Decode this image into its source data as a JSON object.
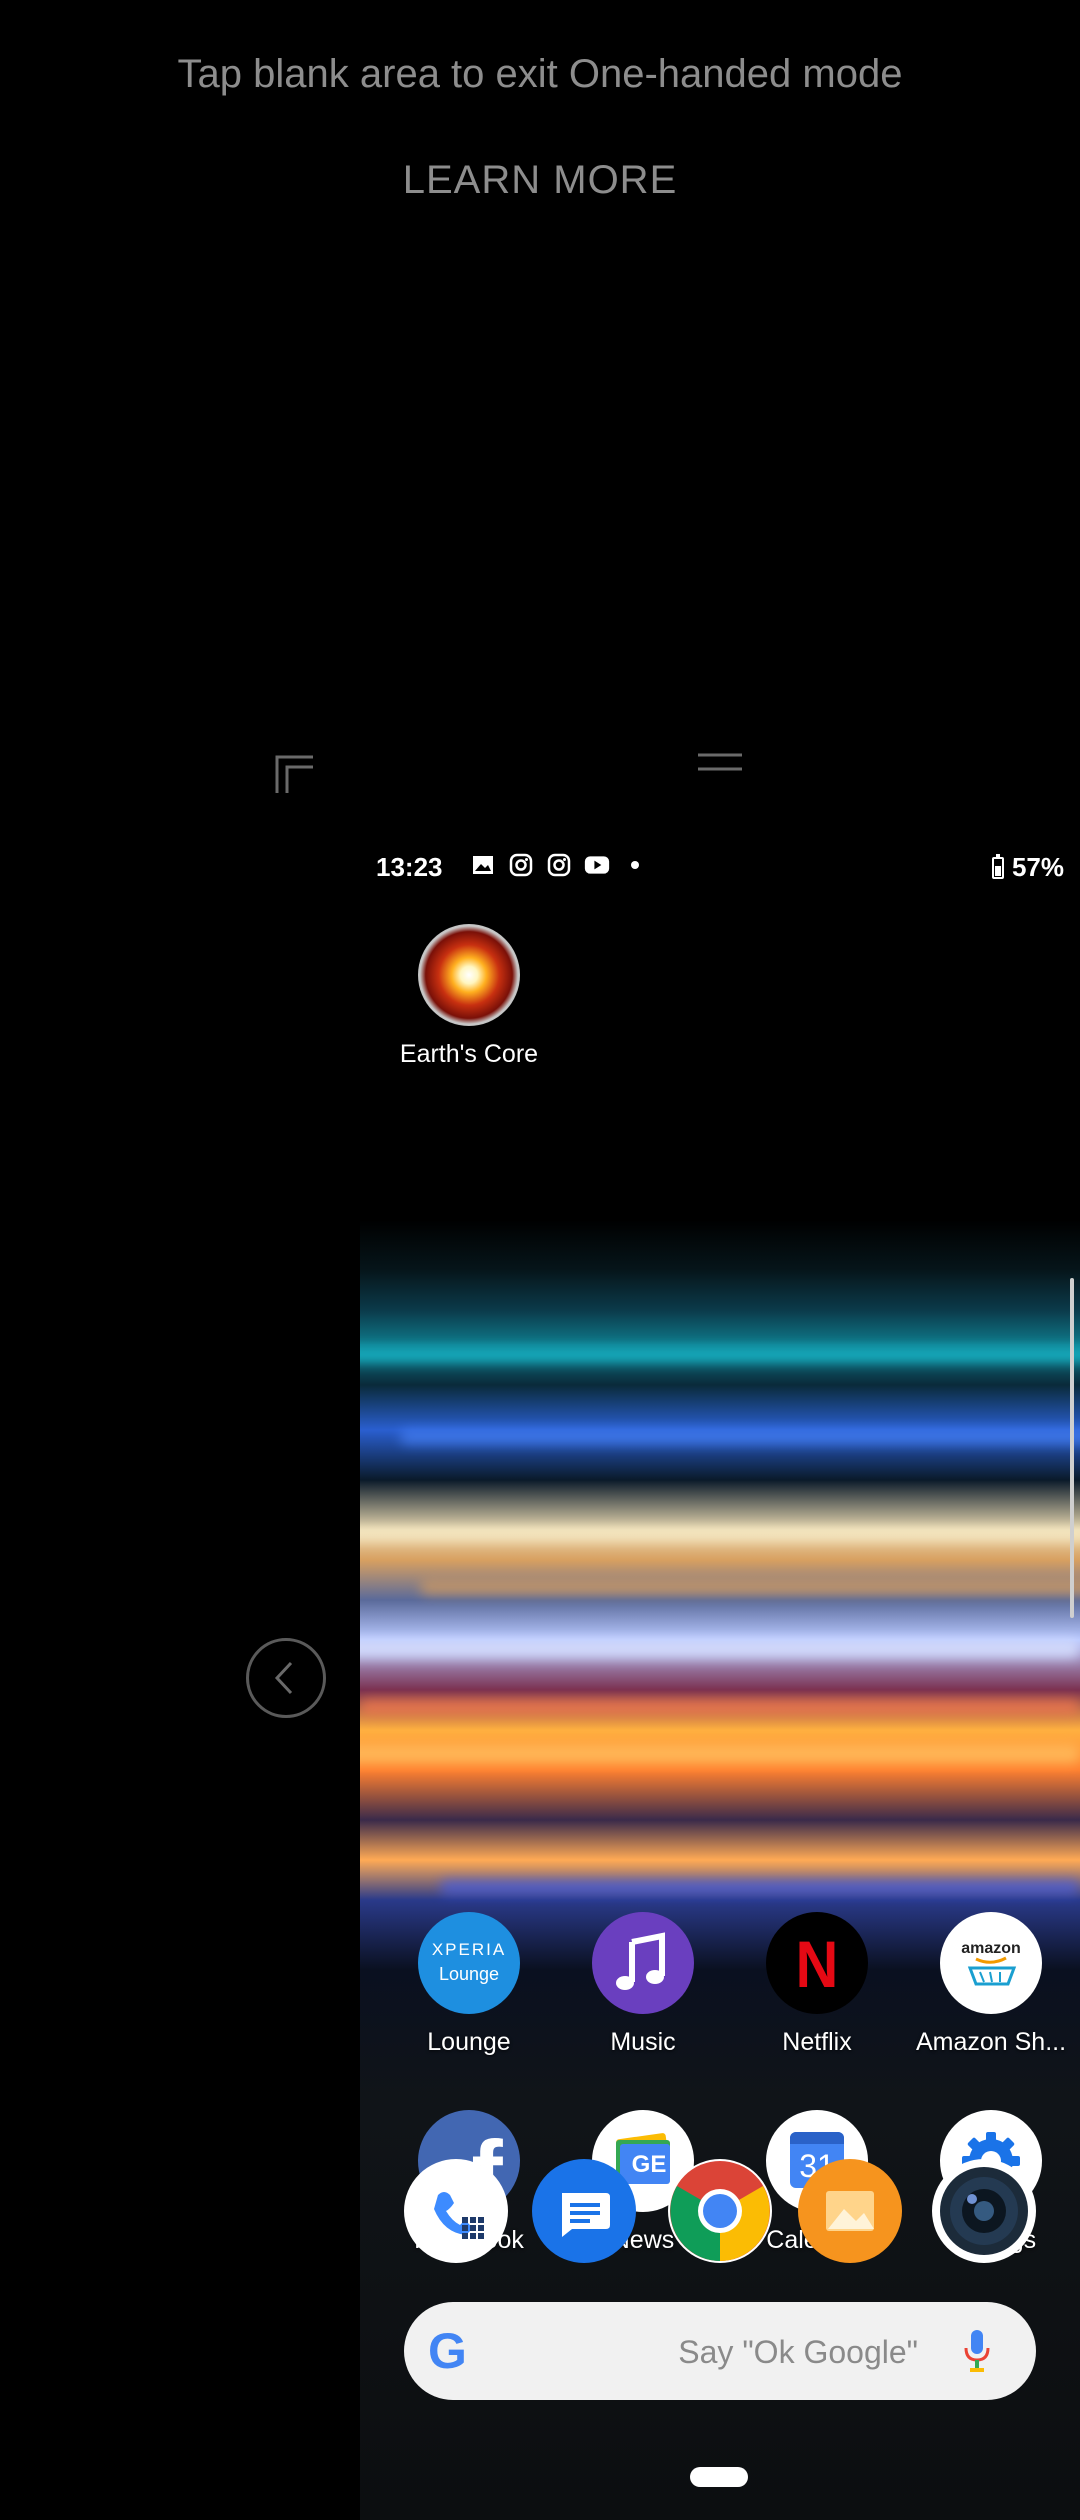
{
  "one_handed": {
    "hint": "Tap blank area to exit One-handed mode",
    "learn_more": "LEARN MORE"
  },
  "status_bar": {
    "time": "13:23",
    "battery": "57%",
    "icons": [
      "image-icon",
      "instagram-icon",
      "instagram-icon",
      "youtube-icon",
      "dot-icon"
    ]
  },
  "home": {
    "widget_app": {
      "label": "Earth's Core",
      "icon": "earths-core-icon"
    },
    "row1": [
      {
        "label": "Lounge",
        "icon": "xperia-lounge-icon",
        "icon_text_top": "XPERIA",
        "icon_text_bottom": "Lounge"
      },
      {
        "label": "Music",
        "icon": "music-icon"
      },
      {
        "label": "Netflix",
        "icon": "netflix-icon",
        "icon_text": "N"
      },
      {
        "label": "Amazon Sh...",
        "icon": "amazon-shopping-icon",
        "icon_text": "amazon"
      }
    ],
    "row2": [
      {
        "label": "Facebook",
        "icon": "facebook-icon",
        "icon_text": "f"
      },
      {
        "label": "News",
        "icon": "google-news-icon",
        "icon_text": "GE"
      },
      {
        "label": "Calendar",
        "icon": "calendar-icon",
        "icon_text": "31"
      },
      {
        "label": "Settings",
        "icon": "settings-gear-icon"
      }
    ],
    "dock": [
      "phone-icon",
      "messages-icon",
      "chrome-icon",
      "gallery-icon",
      "camera-icon"
    ],
    "search": {
      "placeholder": "Say \"Ok Google\"",
      "g_letter": "G"
    }
  },
  "colors": {
    "lounge_blue": "#1e8fe0",
    "music_purple": "#6a3fbf",
    "netflix_red": "#e50914",
    "facebook_blue": "#4267b2",
    "settings_blue": "#1a73e8",
    "calendar_blue": "#4285f4"
  }
}
